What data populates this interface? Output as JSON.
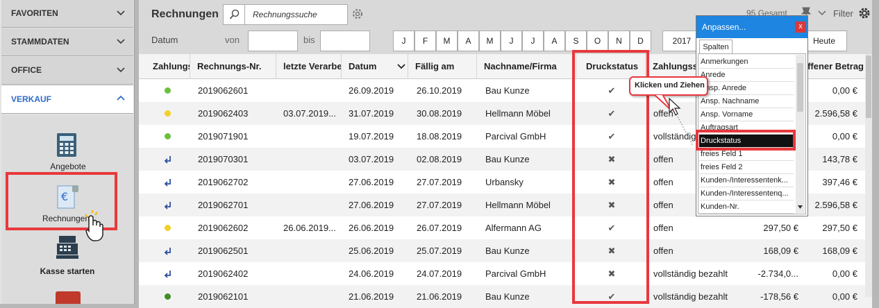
{
  "sidebar": {
    "sections": [
      {
        "label": "FAVORITEN"
      },
      {
        "label": "STAMMDATEN"
      },
      {
        "label": "OFFICE"
      },
      {
        "label": "VERKAUF"
      }
    ],
    "items": [
      {
        "label": "Angebote",
        "icon": "calculator-icon"
      },
      {
        "label": "Rechnungen",
        "icon": "invoice-euro-icon"
      },
      {
        "label": "Kasse starten",
        "icon": "cash-register-icon"
      }
    ]
  },
  "toolbar": {
    "title": "Rechnungen",
    "search_placeholder": "Rechnungssuche",
    "total": "95 Gesamt",
    "filter_label": "Filter",
    "date_label": "Datum",
    "from_label": "von",
    "to_label": "bis",
    "months": [
      "J",
      "F",
      "M",
      "A",
      "M",
      "J",
      "J",
      "A",
      "S",
      "O",
      "N",
      "D"
    ],
    "year": "2017",
    "today_label": "Heute"
  },
  "table": {
    "columns": [
      "Zahlungsstatus",
      "Rechnungs-Nr.",
      "letzte Verarbeitung",
      "Datum",
      "Fällig am",
      "Nachname/Firma",
      "Druckstatus",
      "Zahlungsstatus",
      "offener Betrag"
    ],
    "rows": [
      {
        "status": "green",
        "nr": "2019062601",
        "last": "",
        "date": "26.09.2019",
        "due": "26.10.2019",
        "name": "Bau Kunze",
        "print": "✔",
        "pay": "",
        "amount": "",
        "open": "0,00 €"
      },
      {
        "status": "yellow",
        "nr": "2019062403",
        "last": "03.07.2019...",
        "date": "31.07.2019",
        "due": "30.08.2019",
        "name": "Hellmann Möbel",
        "print": "✔",
        "pay": "offen",
        "amount": "",
        "open": "2.596,58 €"
      },
      {
        "status": "green",
        "nr": "2019071901",
        "last": "",
        "date": "19.07.2019",
        "due": "18.08.2019",
        "name": "Parcival GmbH",
        "print": "✔",
        "pay": "vollständig bezahlt",
        "amount": "",
        "open": "0,00 €"
      },
      {
        "status": "arrow",
        "nr": "2019070301",
        "last": "",
        "date": "03.07.2019",
        "due": "02.08.2019",
        "name": "Bau Kunze",
        "print": "✖",
        "pay": "offen",
        "amount": "",
        "open": "143,78 €"
      },
      {
        "status": "arrow",
        "nr": "2019062702",
        "last": "",
        "date": "27.06.2019",
        "due": "27.07.2019",
        "name": "Urbansky",
        "print": "✖",
        "pay": "offen",
        "amount": "",
        "open": "397,46 €"
      },
      {
        "status": "arrow",
        "nr": "2019062701",
        "last": "",
        "date": "27.06.2019",
        "due": "27.07.2019",
        "name": "Hellmann Möbel",
        "print": "✖",
        "pay": "offen",
        "amount": "",
        "open": "2.596,58 €"
      },
      {
        "status": "yellow",
        "nr": "2019062602",
        "last": "26.06.2019...",
        "date": "26.06.2019",
        "due": "26.07.2019",
        "name": "Alfermann AG",
        "print": "✔",
        "pay": "offen",
        "amount": "297,50 €",
        "open": "297,50 €"
      },
      {
        "status": "arrow",
        "nr": "2019062501",
        "last": "",
        "date": "25.06.2019",
        "due": "25.07.2019",
        "name": "Bau Kunze",
        "print": "✖",
        "pay": "offen",
        "amount": "168,09 €",
        "open": "168,09 €"
      },
      {
        "status": "arrow",
        "nr": "2019062402",
        "last": "",
        "date": "24.06.2019",
        "due": "24.07.2019",
        "name": "Parcival GmbH",
        "print": "✖",
        "pay": "vollständig bezahlt",
        "amount": "-2.734,0...",
        "open": "0,00 €"
      },
      {
        "status": "darkgreen",
        "nr": "2019062101",
        "last": "",
        "date": "21.06.2019",
        "due": "21.06.2019",
        "name": "Bau Kunze",
        "print": "✔",
        "pay": "vollständig bezahlt",
        "amount": "-178,56 €",
        "open": "0,00 €"
      }
    ]
  },
  "popup": {
    "title": "Anpassen...",
    "close": "x",
    "tab": "Spalten",
    "items": [
      "Anmerkungen",
      "Anrede",
      "Ansp. Anrede",
      "Ansp. Nachname",
      "Ansp. Vorname",
      "Auftragsart",
      "Druckstatus",
      "freies Feld 1",
      "freies Feld 2",
      "Kunden-/Interessentenk...",
      "Kunden-/Interessentenq...",
      "Kunden-Nr."
    ],
    "tooltip": "Klicken und Ziehen"
  },
  "colors": {
    "accent": "#2d6bc8",
    "highlight": "#e8383d",
    "popup_title": "#1e86e0",
    "green": "#6cbf3b",
    "yellow": "#f2d024",
    "darkgreen": "#3f8f24"
  }
}
